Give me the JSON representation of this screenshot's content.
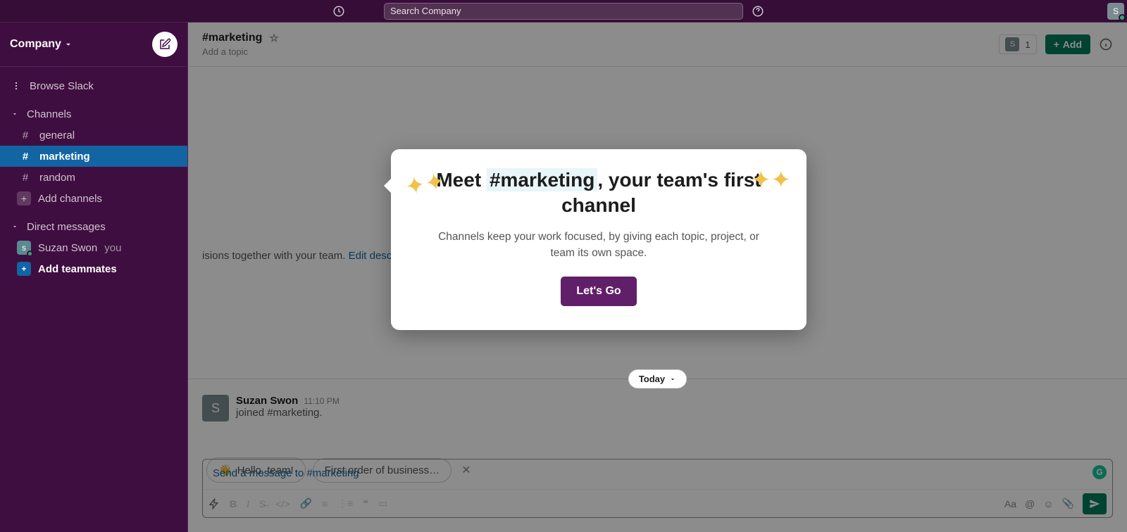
{
  "topbar": {
    "search_placeholder": "Search Company"
  },
  "sidebar": {
    "workspace_name": "Company",
    "browse_label": "Browse Slack",
    "channels_section": "Channels",
    "channels": [
      {
        "name": "general",
        "active": false
      },
      {
        "name": "marketing",
        "active": true
      },
      {
        "name": "random",
        "active": false
      }
    ],
    "add_channels": "Add channels",
    "dm_section": "Direct messages",
    "dm_user": "Suzan Swon",
    "dm_you": "you",
    "add_teammates": "Add teammates"
  },
  "channel_header": {
    "name": "#marketing",
    "topic": "Add a topic",
    "member_count": "1",
    "add_label": "Add"
  },
  "intro": {
    "desc_tail": "isions together with your team. ",
    "edit_link": "Edit description"
  },
  "divider": {
    "label": "Today"
  },
  "message": {
    "author": "Suzan Swon",
    "time": "11:10 PM",
    "text": "joined #marketing.",
    "avatar_letter": "S"
  },
  "suggestions": {
    "pill1": "Hello, team!",
    "pill2": "First order of business…"
  },
  "composer": {
    "placeholder": "Send a message to #marketing"
  },
  "popup": {
    "title_pre": "Meet ",
    "title_hl": "#marketing",
    "title_post": ", your team's first channel",
    "body": "Channels keep your work focused, by giving each topic, project, or team its own space.",
    "cta": "Let's Go"
  }
}
